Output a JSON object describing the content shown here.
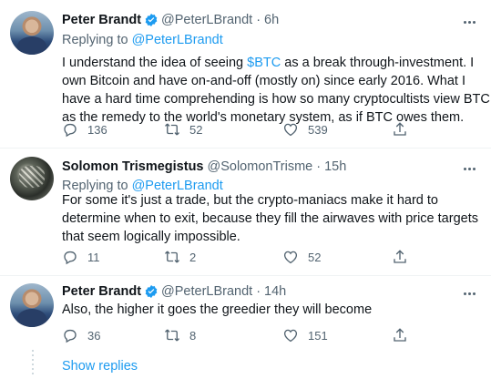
{
  "tweets": [
    {
      "name": "Peter Brandt",
      "handle": "@PeterLBrandt",
      "time": "6h",
      "replying_prefix": "Replying to ",
      "replying_to": "@PeterLBrandt",
      "text_before": "I understand the idea of seeing ",
      "cashtag": "$BTC",
      "text_after": " as a break through-investment. I own Bitcoin and have on-and-off (mostly on) since early 2016. What I have a hard time comprehending is how so many cryptocultists view BTC as the remedy to the world's monetary system, as if BTC owes them.",
      "replies": "136",
      "retweets": "52",
      "likes": "539"
    },
    {
      "name": "Solomon Trismegistus",
      "handle": "@SolomonTrisme",
      "time": "15h",
      "replying_prefix": "Replying to ",
      "replying_to": "@PeterLBrandt",
      "text": "For some it's just a trade, but the crypto-maniacs make it hard to determine when to exit, because they fill the airwaves with price targets that seem logically impossible.",
      "replies": "11",
      "retweets": "2",
      "likes": "52"
    },
    {
      "name": "Peter Brandt",
      "handle": "@PeterLBrandt",
      "time": "14h",
      "text": "Also, the higher it goes the greedier they will become",
      "replies": "36",
      "retweets": "8",
      "likes": "151"
    }
  ],
  "show_replies": "Show replies",
  "dot": "·",
  "colors": {
    "link": "#1d9bf0",
    "secondary": "#536471",
    "verified": "#1d9bf0"
  },
  "icons": [
    "reply-icon",
    "retweet-icon",
    "like-icon",
    "share-icon",
    "verified-badge-icon",
    "more-icon"
  ]
}
